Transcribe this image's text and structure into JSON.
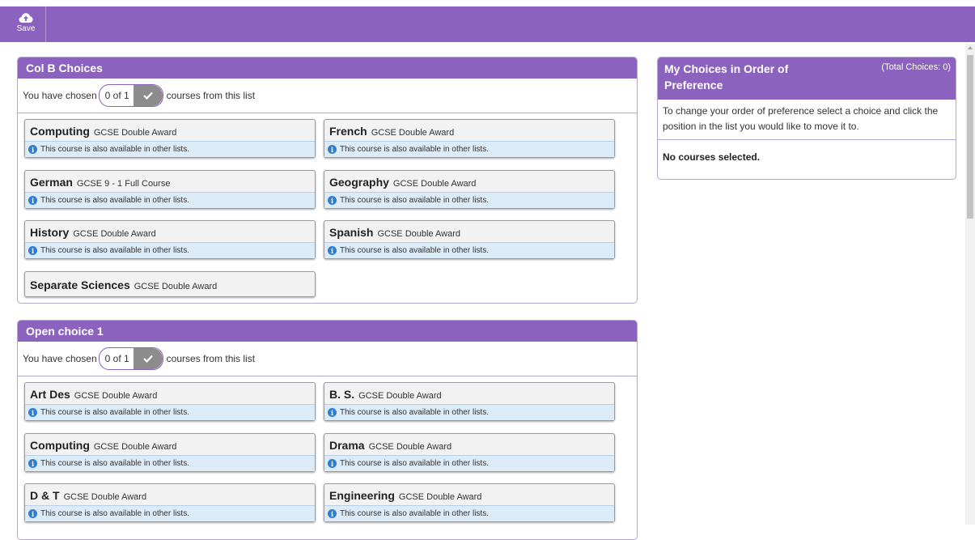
{
  "toolbar": {
    "save_label": "Save"
  },
  "colB": {
    "title": "Col B Choices",
    "chosen_prefix": "You have chosen",
    "chosen_count": "0 of 1",
    "chosen_suffix": "courses from this list",
    "courses": [
      {
        "name": "Computing",
        "type": "GCSE Double Award",
        "info": "This course is also available in other lists."
      },
      {
        "name": "French",
        "type": "GCSE Double Award",
        "info": "This course is also available in other lists."
      },
      {
        "name": "German",
        "type": "GCSE 9 - 1 Full Course",
        "info": "This course is also available in other lists."
      },
      {
        "name": "Geography",
        "type": "GCSE Double Award",
        "info": "This course is also available in other lists."
      },
      {
        "name": "History",
        "type": "GCSE Double Award",
        "info": "This course is also available in other lists."
      },
      {
        "name": "Spanish",
        "type": "GCSE Double Award",
        "info": "This course is also available in other lists."
      },
      {
        "name": "Separate Sciences",
        "type": "GCSE Double Award"
      }
    ]
  },
  "open1": {
    "title": "Open choice 1",
    "chosen_prefix": "You have chosen",
    "chosen_count": "0 of 1",
    "chosen_suffix": "courses from this list",
    "courses": [
      {
        "name": "Art Des",
        "type": "GCSE Double Award",
        "info": "This course is also available in other lists."
      },
      {
        "name": "B. S.",
        "type": "GCSE Double Award",
        "info": "This course is also available in other lists."
      },
      {
        "name": "Computing",
        "type": "GCSE Double Award",
        "info": "This course is also available in other lists."
      },
      {
        "name": "Drama",
        "type": "GCSE Double Award",
        "info": "This course is also available in other lists."
      },
      {
        "name": "D & T",
        "type": "GCSE Double Award",
        "info": "This course is also available in other lists."
      },
      {
        "name": "Engineering",
        "type": "GCSE Double Award",
        "info": "This course is also available in other lists."
      }
    ]
  },
  "myChoices": {
    "title": "My Choices in Order of Preference",
    "total": "(Total Choices: 0)",
    "instructions": "To change your order of preference select a choice and click the position in the list you would like to move it to.",
    "empty": "No courses selected."
  }
}
